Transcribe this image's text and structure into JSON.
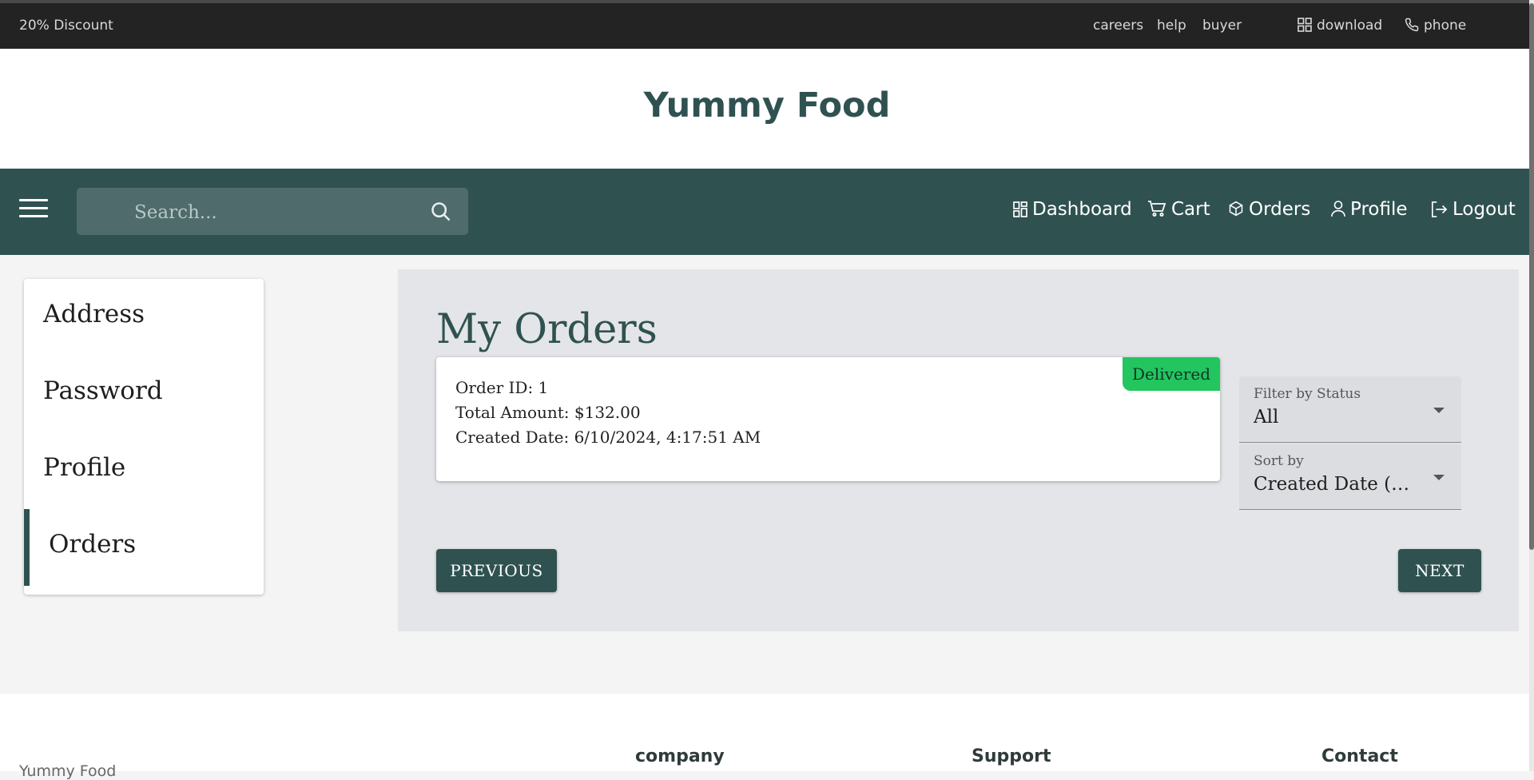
{
  "topbar": {
    "promo": "20% Discount",
    "links": [
      "careers",
      "help",
      "buyer"
    ],
    "download": "download",
    "phone": "phone"
  },
  "brand": {
    "name": "Yummy Food"
  },
  "navbar": {
    "search_placeholder": "Search...",
    "links": {
      "dashboard": "Dashboard",
      "cart": "Cart",
      "orders": "Orders",
      "profile": "Profile",
      "logout": "Logout"
    }
  },
  "sidebar": {
    "items": [
      "Address",
      "Password",
      "Profile",
      "Orders"
    ],
    "active": "Orders"
  },
  "main": {
    "title": "My Orders",
    "order": {
      "id_line": "Order ID: 1",
      "amount_line": "Total Amount: $132.00",
      "date_line": "Created Date: 6/10/2024, 4:17:51 AM",
      "status": "Delivered",
      "status_color": "#22c55e"
    },
    "filter": {
      "label": "Filter by Status",
      "value": "All"
    },
    "sort": {
      "label": "Sort by",
      "value": "Created Date (N..."
    },
    "previous": "PREVIOUS",
    "next": "NEXT"
  },
  "footer": {
    "brand": "Yummy Food",
    "columns": [
      "company",
      "Support",
      "Contact"
    ]
  },
  "colors": {
    "primary": "#2f5251",
    "topbar": "#232323",
    "panel": "#e4e5e8",
    "badge": "#22c55e"
  }
}
